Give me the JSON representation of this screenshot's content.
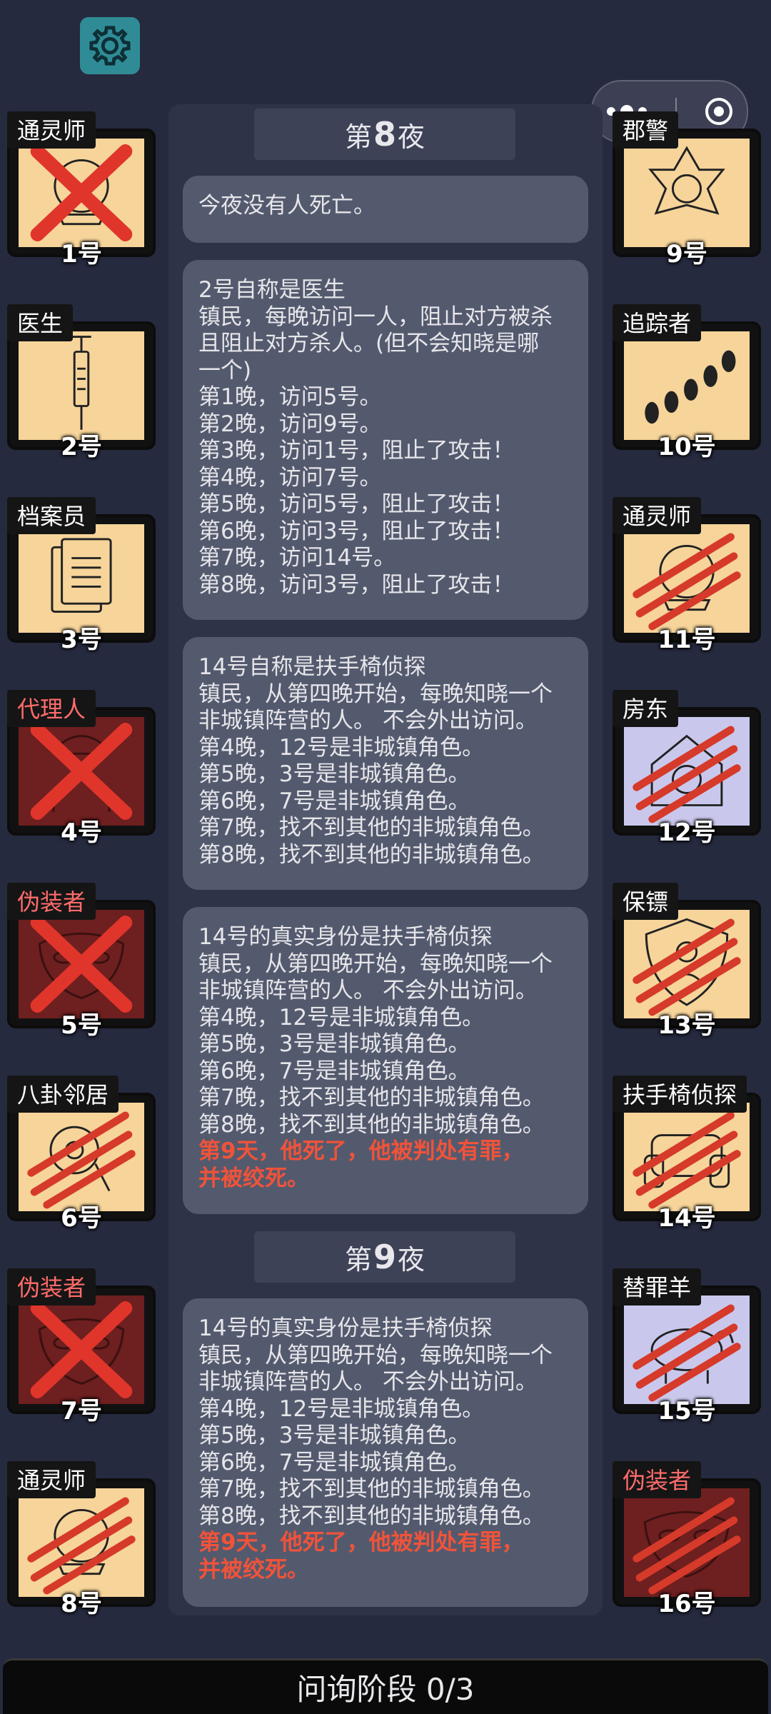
{
  "players": [
    {
      "num": "1号",
      "role": "通灵师",
      "side": "left",
      "state": "dead-x",
      "art": "crystal"
    },
    {
      "num": "2号",
      "role": "医生",
      "side": "left",
      "state": "alive",
      "art": "syringe"
    },
    {
      "num": "3号",
      "role": "档案员",
      "side": "left",
      "state": "alive",
      "art": "docs"
    },
    {
      "num": "4号",
      "role": "代理人",
      "side": "left",
      "state": "dead-x-red",
      "art": "agent"
    },
    {
      "num": "5号",
      "role": "伪装者",
      "side": "left",
      "state": "dead-x-red",
      "art": "mask"
    },
    {
      "num": "6号",
      "role": "八卦邻居",
      "side": "left",
      "state": "slash",
      "art": "gossip"
    },
    {
      "num": "7号",
      "role": "伪装者",
      "side": "left",
      "state": "dead-x-red",
      "art": "mask"
    },
    {
      "num": "8号",
      "role": "通灵师",
      "side": "left",
      "state": "slash",
      "art": "crystal"
    },
    {
      "num": "9号",
      "role": "郡警",
      "side": "right",
      "state": "alive",
      "art": "badge"
    },
    {
      "num": "10号",
      "role": "追踪者",
      "side": "right",
      "state": "alive",
      "art": "footprints"
    },
    {
      "num": "11号",
      "role": "通灵师",
      "side": "right",
      "state": "slash",
      "art": "crystal"
    },
    {
      "num": "12号",
      "role": "房东",
      "side": "right",
      "state": "slash-lav",
      "art": "house"
    },
    {
      "num": "13号",
      "role": "保镖",
      "side": "right",
      "state": "slash",
      "art": "shield"
    },
    {
      "num": "14号",
      "role": "扶手椅侦探",
      "side": "right",
      "state": "slash",
      "art": "chair"
    },
    {
      "num": "15号",
      "role": "替罪羊",
      "side": "right",
      "state": "slash-lav",
      "art": "goat"
    },
    {
      "num": "16号",
      "role": "伪装者",
      "side": "right",
      "state": "slash-red",
      "art": "mask"
    }
  ],
  "nights": [
    {
      "prefix": "第",
      "number": "8",
      "suffix": "夜"
    },
    {
      "prefix": "第",
      "number": "9",
      "suffix": "夜"
    }
  ],
  "messages": [
    {
      "lines": [
        "今夜没有人死亡。"
      ]
    },
    {
      "lines": [
        "2号自称是医生",
        "镇民，每晚访问一人，阻止对方被杀",
        "且阻止对方杀人。(但不会知晓是哪",
        "一个)",
        "第1晚，访问5号。",
        "第2晚，访问9号。",
        "第3晚，访问1号，阻止了攻击！",
        "第4晚，访问7号。",
        "第5晚，访问5号，阻止了攻击！",
        "第6晚，访问3号，阻止了攻击！",
        "第7晚，访问14号。",
        "第8晚，访问3号，阻止了攻击！"
      ]
    },
    {
      "lines": [
        "14号自称是扶手椅侦探",
        "镇民，从第四晚开始，每晚知晓一个",
        "非城镇阵营的人。 不会外出访问。",
        "第4晚，12号是非城镇角色。",
        "第5晚，3号是非城镇角色。",
        "第6晚，7号是非城镇角色。",
        "第7晚，找不到其他的非城镇角色。",
        "第8晚，找不到其他的非城镇角色。"
      ]
    },
    {
      "lines": [
        "14号的真实身份是扶手椅侦探",
        "镇民，从第四晚开始，每晚知晓一个",
        "非城镇阵营的人。 不会外出访问。",
        "第4晚，12号是非城镇角色。",
        "第5晚，3号是非城镇角色。",
        "第6晚，7号是非城镇角色。",
        "第7晚，找不到其他的非城镇角色。",
        "第8晚，找不到其他的非城镇角色。"
      ],
      "highlight": [
        "第9天，他死了，他被判处有罪，",
        "并被绞死。"
      ]
    },
    {
      "lines": [
        "14号的真实身份是扶手椅侦探",
        "镇民，从第四晚开始，每晚知晓一个",
        "非城镇阵营的人。 不会外出访问。",
        "第4晚，12号是非城镇角色。",
        "第5晚，3号是非城镇角色。",
        "第6晚，7号是非城镇角色。",
        "第7晚，找不到其他的非城镇角色。",
        "第8晚，找不到其他的非城镇角色。"
      ],
      "highlight": [
        "第9天，他死了，他被判处有罪，",
        "并被绞死。"
      ]
    }
  ],
  "phase": {
    "label": "问询阶段 0/3"
  },
  "icons": {
    "settings": "gear-icon",
    "menu": "more-dots-icon",
    "close": "target-circle-icon"
  },
  "colors": {
    "highlight": "#f0533a",
    "card_alive": "#f6d49a",
    "card_dead": "#6e1f1f",
    "card_lavender": "#c9c8ec",
    "scratch": "#d63a2a"
  }
}
